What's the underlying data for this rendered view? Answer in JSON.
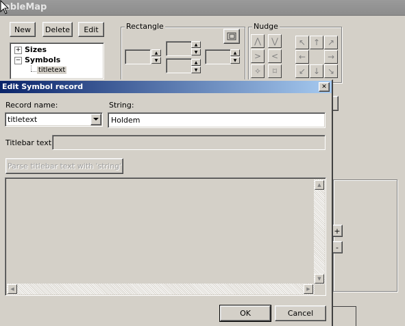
{
  "main_window": {
    "title": "ableMap",
    "toolbar": {
      "new_label": "New",
      "delete_label": "Delete",
      "edit_label": "Edit"
    },
    "tree": {
      "items": [
        {
          "label": "Sizes",
          "expander": "+"
        },
        {
          "label": "Symbols",
          "expander": "−"
        },
        {
          "label": "titletext"
        }
      ]
    },
    "rectangle_group": {
      "label": "Rectangle"
    },
    "nudge_group": {
      "label": "Nudge"
    },
    "side_plus": "+",
    "side_minus": "-"
  },
  "dialog": {
    "title": "Edit Symbol record",
    "close_glyph": "✕",
    "record_name_label": "Record name:",
    "record_name_value": "titletext",
    "string_label": "String:",
    "string_value": "Holdem",
    "titlebar_text_label": "Titlebar text:",
    "titlebar_text_value": "",
    "parse_button_label": "Parse titlebar text with 'string'",
    "ok_label": "OK",
    "cancel_label": "Cancel"
  },
  "colors": {
    "dialog_title_start": "#0a246a",
    "dialog_title_end": "#a6caf0",
    "window_face": "#d4d0c8"
  }
}
